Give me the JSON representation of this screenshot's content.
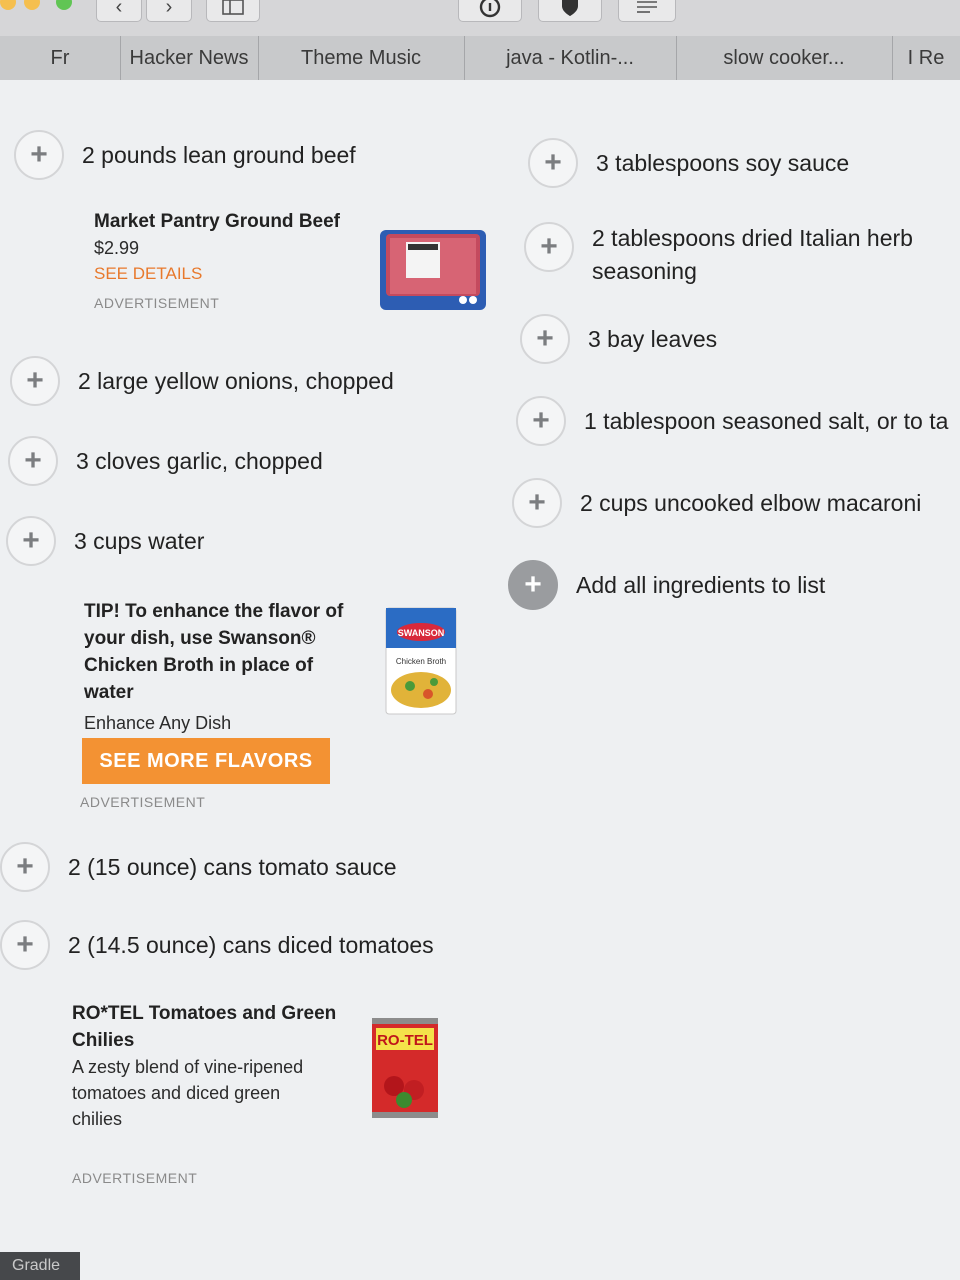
{
  "browser": {
    "tabs": [
      "Fr",
      "Hacker News",
      "Theme Music",
      "java - Kotlin-...",
      "slow cooker...",
      "I Re"
    ]
  },
  "left_ingredients": [
    "2 pounds lean ground beef",
    "2 large yellow onions, chopped",
    "3 cloves garlic, chopped",
    "3 cups water",
    "2 (15 ounce) cans tomato sauce",
    "2 (14.5 ounce) cans diced tomatoes"
  ],
  "right_ingredients": [
    "3 tablespoons soy sauce",
    "2 tablespoons dried Italian herb seasoning",
    "3 bay leaves",
    "1 tablespoon seasoned salt, or to ta",
    "2 cups uncooked elbow macaroni"
  ],
  "add_all_label": "Add all ingredients to list",
  "ad_beef": {
    "title": "Market Pantry Ground Beef",
    "price": "$2.99",
    "link": "SEE DETAILS",
    "label": "ADVERTISEMENT"
  },
  "ad_swanson": {
    "title_lines": [
      "TIP! To enhance the flavor of",
      "your dish, use Swanson®",
      "Chicken Broth in place of",
      "water"
    ],
    "subtitle": "Enhance Any Dish",
    "button": "SEE MORE FLAVORS",
    "label": "ADVERTISEMENT",
    "package_text": "Chicken Broth",
    "brand": "SWANSON"
  },
  "ad_rotel": {
    "title_lines": [
      "RO*TEL Tomatoes and Green",
      "Chilies"
    ],
    "desc_lines": [
      "A zesty blend of vine-ripened",
      "tomatoes and diced green",
      "chilies"
    ],
    "label": "ADVERTISEMENT",
    "can_text": "RO-TEL"
  },
  "status_bar": "Gradle",
  "colors": {
    "accent_orange": "#f39233",
    "link_orange": "#e8792c",
    "plus_border": "#d4d5d7",
    "page_bg": "#eef0f2"
  },
  "icons": [
    "plus-icon",
    "share-icon",
    "info-icon",
    "shield-icon",
    "reader-icon"
  ]
}
